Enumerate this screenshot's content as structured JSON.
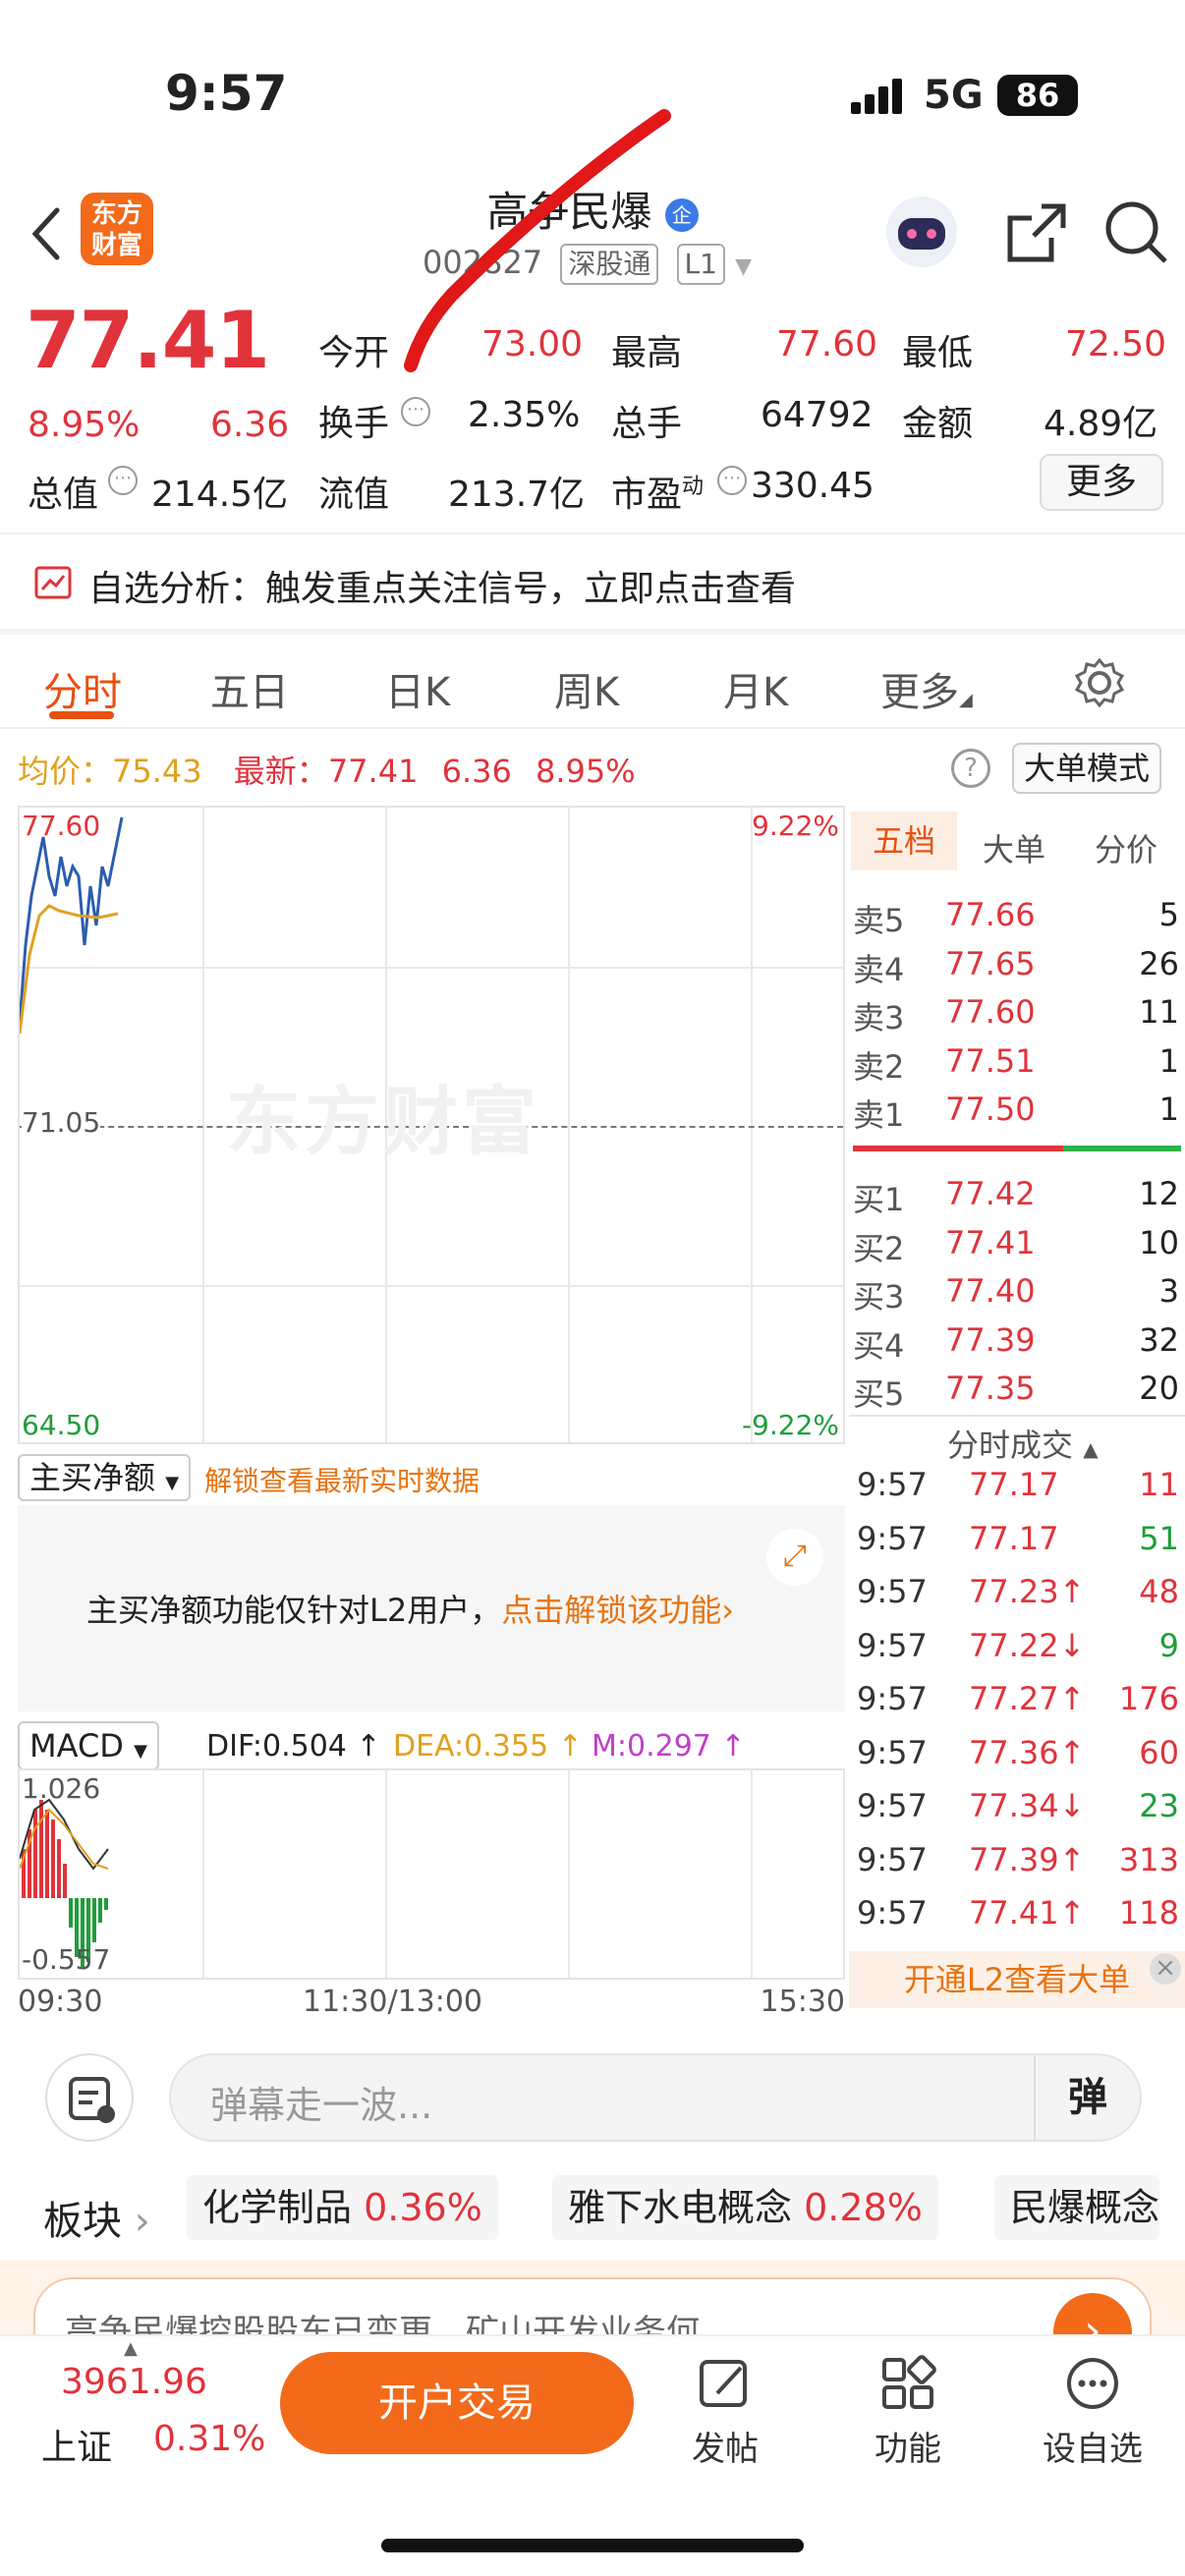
{
  "status_bar": {
    "time": "9:57",
    "network": "5G",
    "battery": "86"
  },
  "header": {
    "logo_line1": "东方",
    "logo_line2": "财富",
    "title": "高争民爆",
    "badge": "企",
    "code": "002827",
    "market_tag": "深股通",
    "level_tag": "L1"
  },
  "quote": {
    "price": "77.41",
    "change_pct": "8.95%",
    "change": "6.36",
    "open_label": "今开",
    "open": "73.00",
    "high_label": "最高",
    "high": "77.60",
    "low_label": "最低",
    "low": "72.50",
    "turnover_label": "换手",
    "turnover": "2.35%",
    "volume_label": "总手",
    "volume": "64792",
    "amount_label": "金额",
    "amount": "4.89亿",
    "mktcap_label": "总值",
    "mktcap": "214.5亿",
    "float_label": "流值",
    "float": "213.7亿",
    "pe_label": "市盈",
    "pe_sup": "动",
    "pe": "330.45",
    "more": "更多"
  },
  "alert": {
    "text": "自选分析：触发重点关注信号，立即点击查看"
  },
  "tabs": [
    "分时",
    "五日",
    "日K",
    "周K",
    "月K",
    "更多"
  ],
  "intraday": {
    "avg_label": "均价：",
    "avg": "75.43",
    "latest_label": "最新：",
    "latest": "77.41",
    "latest_chg": "6.36",
    "latest_pct": "8.95%",
    "bigorder_mode": "大单模式",
    "top_price": "77.60",
    "mid_price": "71.05",
    "bottom_price": "64.50",
    "top_pct": "9.22%",
    "bottom_pct": "-9.22%",
    "watermark": "东方财富"
  },
  "orderbook": {
    "tabs": [
      "五档",
      "大单",
      "分价"
    ],
    "asks": [
      {
        "label": "卖5",
        "price": "77.66",
        "vol": "5"
      },
      {
        "label": "卖4",
        "price": "77.65",
        "vol": "26"
      },
      {
        "label": "卖3",
        "price": "77.60",
        "vol": "11"
      },
      {
        "label": "卖2",
        "price": "77.51",
        "vol": "1"
      },
      {
        "label": "卖1",
        "price": "77.50",
        "vol": "1"
      }
    ],
    "bids": [
      {
        "label": "买1",
        "price": "77.42",
        "vol": "12"
      },
      {
        "label": "买2",
        "price": "77.41",
        "vol": "10"
      },
      {
        "label": "买3",
        "price": "77.40",
        "vol": "3"
      },
      {
        "label": "买4",
        "price": "77.39",
        "vol": "32"
      },
      {
        "label": "买5",
        "price": "77.35",
        "vol": "20"
      }
    ]
  },
  "time_sales": {
    "title": "分时成交",
    "rows": [
      {
        "t": "9:57",
        "p": "77.17",
        "v": "11",
        "c": "red"
      },
      {
        "t": "9:57",
        "p": "77.17",
        "v": "51",
        "c": "green"
      },
      {
        "t": "9:57",
        "p": "77.23↑",
        "v": "48",
        "c": "red"
      },
      {
        "t": "9:57",
        "p": "77.22↓",
        "v": "9",
        "c": "green"
      },
      {
        "t": "9:57",
        "p": "77.27↑",
        "v": "176",
        "c": "red"
      },
      {
        "t": "9:57",
        "p": "77.36↑",
        "v": "60",
        "c": "red"
      },
      {
        "t": "9:57",
        "p": "77.34↓",
        "v": "23",
        "c": "green"
      },
      {
        "t": "9:57",
        "p": "77.39↑",
        "v": "313",
        "c": "red"
      },
      {
        "t": "9:57",
        "p": "77.41↑",
        "v": "118",
        "c": "red"
      }
    ],
    "open_l2": "开通L2查看大单"
  },
  "main_buy": {
    "select": "主买净额",
    "unlock_link": "解锁查看最新实时数据",
    "locked_text": "主买净额功能仅针对L2用户，",
    "locked_link": "点击解锁该功能"
  },
  "macd": {
    "select": "MACD",
    "dif": "DIF:0.504 ↑",
    "dea": "DEA:0.355 ↑",
    "m": "M:0.297 ↑",
    "top": "1.026",
    "bottom": "-0.557"
  },
  "time_axis": [
    "09:30",
    "11:30/13:00",
    "15:30"
  ],
  "comment": {
    "placeholder": "弹幕走一波...",
    "danmu": "弹"
  },
  "sectors": {
    "label": "板块",
    "items": [
      {
        "name": "化学制品",
        "pct": "0.36%"
      },
      {
        "name": "雅下水电概念",
        "pct": "0.28%"
      },
      {
        "name": "民爆概念",
        "pct": ""
      }
    ]
  },
  "news": {
    "text": "高争民爆控股股东已变更，矿山开发业务何"
  },
  "bottom_bar": {
    "index_value": "3961.96",
    "index_name": "上证",
    "index_pct": "0.31%",
    "trade": "开户交易",
    "post": "发帖",
    "func": "功能",
    "watch": "设自选"
  },
  "colors": {
    "up": "#e0333b",
    "down": "#1e9e3a",
    "accent": "#f26a1a"
  }
}
